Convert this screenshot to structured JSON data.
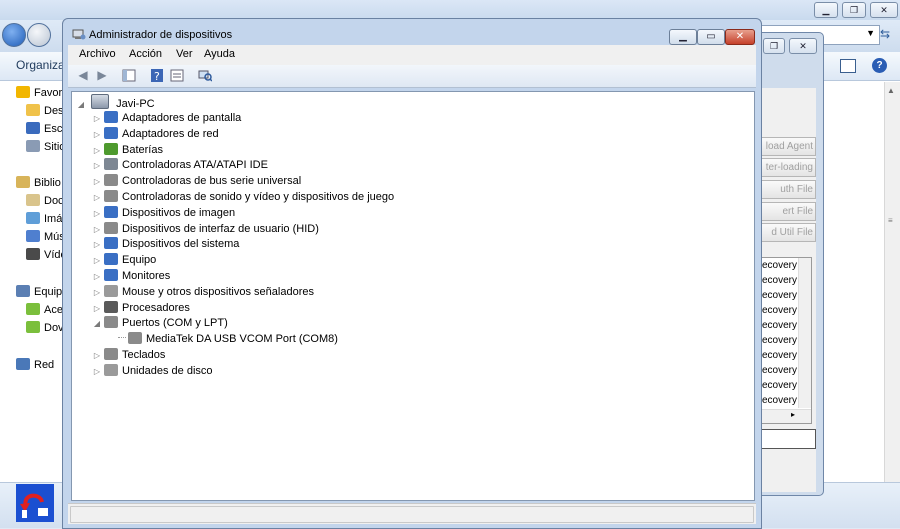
{
  "explorer": {
    "organize_label": "Organizar",
    "nav_items": [
      {
        "label": "Favor",
        "icon": "star-icon",
        "color": "#f2b600"
      },
      {
        "label": "Des",
        "icon": "desktop-folder-icon",
        "color": "#f0c24a"
      },
      {
        "label": "Escr",
        "icon": "desktop-icon",
        "color": "#3a6bbd"
      },
      {
        "label": "Sitio",
        "icon": "recent-places-icon",
        "color": "#8a9bb4"
      },
      {
        "label": "Biblio",
        "icon": "libraries-icon",
        "color": "#d8b45a"
      },
      {
        "label": "Doc",
        "icon": "documents-icon",
        "color": "#d9c48c"
      },
      {
        "label": "Imá",
        "icon": "pictures-icon",
        "color": "#5f9ed8"
      },
      {
        "label": "Mús",
        "icon": "music-icon",
        "color": "#4f7fcf"
      },
      {
        "label": "Víde",
        "icon": "videos-icon",
        "color": "#4a4a4a"
      },
      {
        "label": "Equip",
        "icon": "computer-icon",
        "color": "#5b7fb3"
      },
      {
        "label": "Ace",
        "icon": "android-icon",
        "color": "#7bbf3c"
      },
      {
        "label": "Dov",
        "icon": "android-icon",
        "color": "#7bbf3c"
      },
      {
        "label": "Red",
        "icon": "network-icon",
        "color": "#4a78b8"
      }
    ]
  },
  "tool": {
    "buttons": [
      "load Agent",
      "ter-loading",
      "uth File",
      "ert File",
      "d Util File"
    ],
    "log_lines": [
      "recovery",
      "recovery",
      "recovery",
      "recovery",
      "recovery",
      "recovery",
      "recovery",
      "recovery",
      "recovery",
      "recovery"
    ]
  },
  "devmgr": {
    "title": "Administrador de dispositivos",
    "menu": [
      "Archivo",
      "Acción",
      "Ver",
      "Ayuda"
    ],
    "root_label": "Javi-PC",
    "categories": [
      {
        "label": "Adaptadores de pantalla",
        "icon": "display-adapter-icon",
        "color": "#3a6fc4"
      },
      {
        "label": "Adaptadores de red",
        "icon": "network-adapter-icon",
        "color": "#3a6fc4"
      },
      {
        "label": "Baterías",
        "icon": "battery-icon",
        "color": "#4e9a2e"
      },
      {
        "label": "Controladoras ATA/ATAPI IDE",
        "icon": "ide-controller-icon",
        "color": "#7d8793"
      },
      {
        "label": "Controladoras de bus serie universal",
        "icon": "usb-controller-icon",
        "color": "#8a8a8a"
      },
      {
        "label": "Controladoras de sonido y vídeo y dispositivos de juego",
        "icon": "sound-icon",
        "color": "#8a8a8a"
      },
      {
        "label": "Dispositivos de imagen",
        "icon": "camera-icon",
        "color": "#3a6fc4"
      },
      {
        "label": "Dispositivos de interfaz de usuario (HID)",
        "icon": "hid-icon",
        "color": "#8a8a8a"
      },
      {
        "label": "Dispositivos del sistema",
        "icon": "system-devices-icon",
        "color": "#3a6fc4"
      },
      {
        "label": "Equipo",
        "icon": "computer-icon",
        "color": "#3a6fc4"
      },
      {
        "label": "Monitores",
        "icon": "monitor-icon",
        "color": "#3a6fc4"
      },
      {
        "label": "Mouse y otros dispositivos señaladores",
        "icon": "mouse-icon",
        "color": "#9a9a9a"
      },
      {
        "label": "Procesadores",
        "icon": "processor-icon",
        "color": "#5a5a5a"
      },
      {
        "label": "Puertos (COM y LPT)",
        "icon": "ports-icon",
        "color": "#8a8a8a",
        "expanded": true,
        "children": [
          {
            "label": "MediaTek DA USB VCOM Port (COM8)",
            "icon": "port-device-icon",
            "color": "#8a8a8a"
          }
        ]
      },
      {
        "label": "Teclados",
        "icon": "keyboard-icon",
        "color": "#8a8a8a"
      },
      {
        "label": "Unidades de disco",
        "icon": "disk-drive-icon",
        "color": "#9a9a9a"
      }
    ]
  }
}
